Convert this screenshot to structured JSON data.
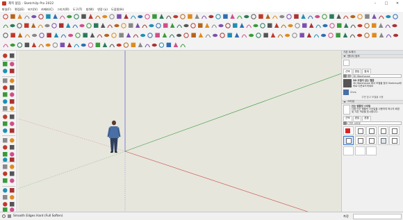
{
  "window": {
    "title": "제목 없음 - SketchUp Pro 2022",
    "controls": [
      "minimize-icon",
      "maximize-icon",
      "close-icon"
    ]
  },
  "menu": {
    "items": [
      "파일(F)",
      "편집(E)",
      "보기(V)",
      "카메라(C)",
      "그리기(R)",
      "도구(T)",
      "창(W)",
      "연장 (x)",
      "도움말(H)"
    ]
  },
  "left_toolbar_groups": [
    "select",
    "eraser",
    "paint",
    "line",
    "arc",
    "shape",
    "push-pull",
    "move",
    "rotate",
    "offset",
    "scale",
    "tape",
    "text",
    "axes",
    "section",
    "orbit",
    "pan",
    "zoom",
    "walk",
    "look-around",
    "position-camera"
  ],
  "tray": {
    "title": "기본 트레이",
    "entity_info": {
      "header": "엔티티 정보"
    },
    "components": {
      "tabs": [
        "선택",
        "편집",
        "통계"
      ],
      "search_value": "3D Warehouse",
      "item_title": "3D 모델이 있는 웹폼",
      "item_desc": "3D Warehouse 에서 모델을 찾아 Sketchup에 바로 다운로드하세요",
      "item_label": "Chris",
      "note": "주변 참고 모델을 사용"
    },
    "styles": {
      "header": "스타일",
      "style_name": "단순 템플릿 스타일",
      "style_desc": "다음 단순 템플릿 스타일을 사용하여 하나의 배경 및 기본 색상을 표시합니다.",
      "tabs": [
        "선택",
        "편집",
        "혼합"
      ],
      "dropdown": "기본 스타일"
    }
  },
  "status": {
    "text": "Smooth Edges Hard (Full Soften)",
    "measurement_label": "측정"
  },
  "colors": {
    "viewport_bg": "#e6e6dd",
    "axis_red": "#c8403d",
    "axis_green": "#3a9a3a",
    "axis_blue": "#3a3ad0",
    "toolbar_bg": "#f3f3f3"
  }
}
